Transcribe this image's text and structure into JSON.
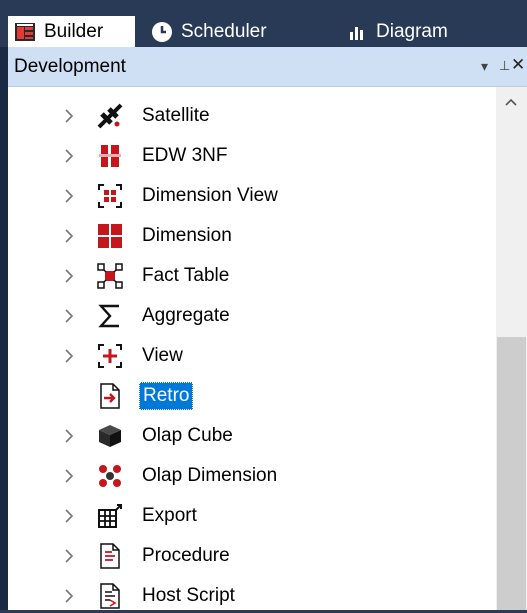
{
  "tabs": [
    {
      "label": "Builder",
      "icon": "builder-icon",
      "active": true
    },
    {
      "label": "Scheduler",
      "icon": "clock-icon",
      "active": false
    },
    {
      "label": "Diagram",
      "icon": "bar-chart-icon",
      "active": false
    }
  ],
  "panel": {
    "title": "Development",
    "dropdown_glyph": "▾",
    "pin_glyph": "⊥",
    "close_glyph": "✕"
  },
  "tree": {
    "items": [
      {
        "label": "Satellite",
        "icon": "satellite-icon",
        "expandable": true
      },
      {
        "label": "EDW 3NF",
        "icon": "edw-3nf-icon",
        "expandable": true
      },
      {
        "label": "Dimension View",
        "icon": "dimension-view-icon",
        "expandable": true
      },
      {
        "label": "Dimension",
        "icon": "dimension-icon",
        "expandable": true
      },
      {
        "label": "Fact Table",
        "icon": "fact-table-icon",
        "expandable": true
      },
      {
        "label": "Aggregate",
        "icon": "sigma-icon",
        "expandable": true
      },
      {
        "label": "View",
        "icon": "view-icon",
        "expandable": true
      },
      {
        "label": "Retro",
        "icon": "retro-icon",
        "expandable": false,
        "selected": true
      },
      {
        "label": "Olap Cube",
        "icon": "olap-cube-icon",
        "expandable": true
      },
      {
        "label": "Olap Dimension",
        "icon": "olap-dimension-icon",
        "expandable": true
      },
      {
        "label": "Export",
        "icon": "export-icon",
        "expandable": true
      },
      {
        "label": "Procedure",
        "icon": "procedure-icon",
        "expandable": true
      },
      {
        "label": "Host Script",
        "icon": "host-script-icon",
        "expandable": true
      }
    ]
  },
  "colors": {
    "tab_bg": "#293a57",
    "header_bg": "#cfe0f5",
    "selection": "#0078d7",
    "icon_red": "#c4161c"
  }
}
